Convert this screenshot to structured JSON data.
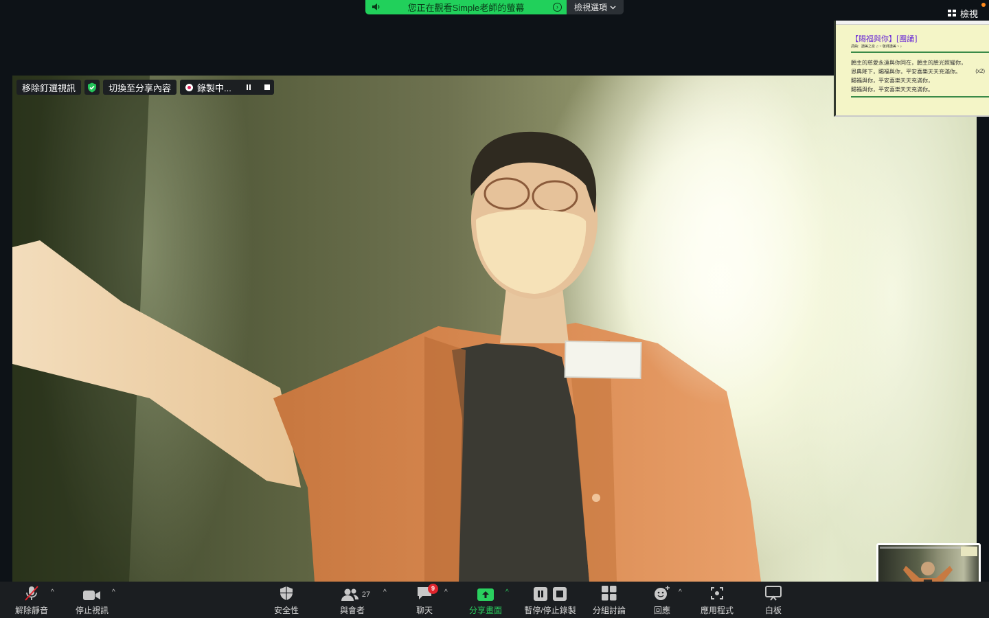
{
  "banner": {
    "viewing_text": "您正在觀看Simple老師的螢幕",
    "view_options_label": "檢視選項"
  },
  "top_right": {
    "view_label": "檢視"
  },
  "video_controls": {
    "unpin_label": "移除釘選視訊",
    "switch_share_label": "切換至分享內容",
    "recording_label": "錄製中..."
  },
  "lyrics": {
    "title": "【賜福與你】[團誦]",
    "subtitle": "詞曲：讚美之泉 ♫ ~ 敬拜讚美 ~ ♪",
    "lines": [
      "願主的慈愛永遠與你同在，願主的臉光照耀你，",
      "恩典降下，賜福與你，平安喜樂天天充滿你。",
      "賜福與你，平安喜樂天天充滿你，",
      "賜福與你，平安喜樂天天充滿你。"
    ],
    "repeat_mark": "(x2)"
  },
  "toolbar": {
    "mute_label": "解除靜音",
    "video_label": "停止視訊",
    "security_label": "安全性",
    "participants_label": "與會者",
    "participants_count": "27",
    "chat_label": "聊天",
    "chat_badge": "9",
    "share_label": "分享畫面",
    "record_label": "暫停/停止錄製",
    "breakout_label": "分組討論",
    "reactions_label": "回應",
    "apps_label": "應用程式",
    "whiteboard_label": "白板"
  },
  "colors": {
    "share_green": "#21d05b",
    "toolbar_bg": "#1b1e21",
    "badge_red": "#e0242c",
    "lyric_title_purple": "#6b2bd6"
  }
}
